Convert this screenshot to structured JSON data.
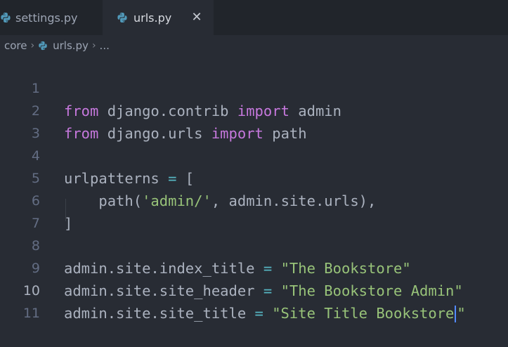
{
  "tabs": [
    {
      "label": "settings.py",
      "icon": "python-icon",
      "active": false
    },
    {
      "label": "urls.py",
      "icon": "python-icon",
      "active": true,
      "close": "✕"
    }
  ],
  "breadcrumb": {
    "folder": "core",
    "file": "urls.py",
    "more": "..."
  },
  "editor": {
    "lines": [
      {
        "num": "1",
        "text": "from django.contrib import admin"
      },
      {
        "num": "2",
        "text": "from django.urls import path"
      },
      {
        "num": "3",
        "text": ""
      },
      {
        "num": "4",
        "text": "urlpatterns = ["
      },
      {
        "num": "5",
        "text": "    path('admin/', admin.site.urls),"
      },
      {
        "num": "6",
        "text": "]"
      },
      {
        "num": "7",
        "text": ""
      },
      {
        "num": "8",
        "text": "admin.site.index_title = \"The Bookstore\""
      },
      {
        "num": "9",
        "text": "admin.site.site_header = \"The Bookstore Admin\""
      },
      {
        "num": "10",
        "text": "admin.site.site_title = \"Site Title Bookstore\""
      },
      {
        "num": "11",
        "text": ""
      }
    ]
  },
  "colors": {
    "keyword": "#c678dd",
    "string": "#98c379",
    "operator": "#56b6c2",
    "text": "#abb2bf",
    "background": "#282c34",
    "cursor": "#528bff"
  }
}
